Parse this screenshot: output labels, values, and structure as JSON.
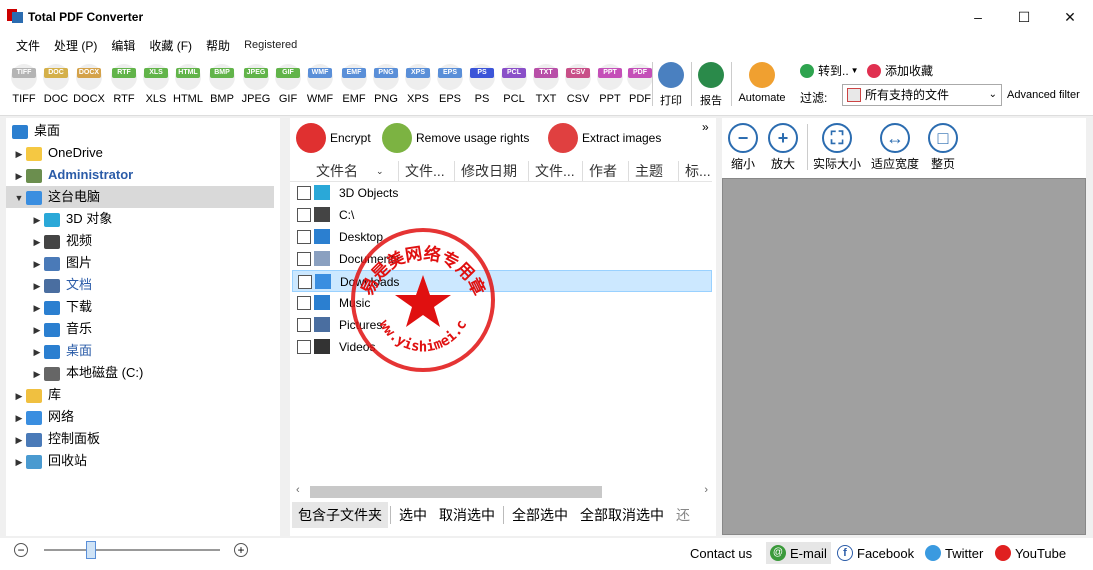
{
  "window": {
    "title": "Total PDF Converter"
  },
  "menu": {
    "items": [
      "文件",
      "处理 (P)",
      "编辑",
      "收藏 (F)",
      "帮助"
    ],
    "registered": "Registered"
  },
  "formats": [
    "TIFF",
    "DOC",
    "DOCX",
    "RTF",
    "XLS",
    "HTML",
    "BMP",
    "JPEG",
    "GIF",
    "WMF",
    "EMF",
    "PNG",
    "XPS",
    "EPS",
    "PS",
    "PCL",
    "TXT",
    "CSV",
    "PPT",
    "PDF"
  ],
  "format_colors": [
    "#b4b4b4",
    "#d4b04a",
    "#d4a24a",
    "#62b44a",
    "#62b44a",
    "#62b44a",
    "#62b44a",
    "#62b44a",
    "#62b44a",
    "#5a8fd8",
    "#5a8fd8",
    "#5a8fd8",
    "#5a8fd8",
    "#5a8fd8",
    "#3c55d8",
    "#8a4fc8",
    "#b84fa8",
    "#c84f88",
    "#c44fb8",
    "#c44fb8"
  ],
  "toolbar": {
    "print": "打印",
    "report": "报告",
    "automate": "Automate",
    "goto": "转到..",
    "add_favorite": "添加收藏",
    "filter_label": "过滤:",
    "filter_value": "所有支持的文件",
    "advanced_filter": "Advanced filter"
  },
  "tree": {
    "root": "桌面",
    "items": [
      {
        "label": "OneDrive",
        "level": 1
      },
      {
        "label": "Administrator",
        "level": 1
      },
      {
        "label": "这台电脑",
        "level": 1
      },
      {
        "label": "3D 对象",
        "level": 2
      },
      {
        "label": "视频",
        "level": 2
      },
      {
        "label": "图片",
        "level": 2
      },
      {
        "label": "文档",
        "level": 2
      },
      {
        "label": "下载",
        "level": 2
      },
      {
        "label": "音乐",
        "level": 2
      },
      {
        "label": "桌面",
        "level": 2
      },
      {
        "label": "本地磁盘 (C:)",
        "level": 2
      },
      {
        "label": "库",
        "level": 1
      },
      {
        "label": "网络",
        "level": 1
      },
      {
        "label": "控制面板",
        "level": 1
      },
      {
        "label": "回收站",
        "level": 1
      }
    ]
  },
  "actions": {
    "encrypt": "Encrypt",
    "remove_rights": "Remove usage rights",
    "extract_images": "Extract images"
  },
  "columns": [
    "文件名",
    "文件...",
    "修改日期",
    "文件...",
    "作者",
    "主题",
    "标..."
  ],
  "files": [
    "3D Objects",
    "C:\\",
    "Desktop",
    "Documents",
    "Downloads",
    "Music",
    "Pictures",
    "Videos"
  ],
  "bottom_tabs": {
    "include_sub": "包含子文件夹",
    "select": "选中",
    "deselect": "取消选中",
    "select_all": "全部选中",
    "deselect_all": "全部取消选中",
    "more": "还"
  },
  "zoom": {
    "zoom_out": "缩小",
    "zoom_in": "放大",
    "actual_size": "实际大小",
    "fit_width": "适应宽度",
    "whole_page": "整页"
  },
  "status": {
    "contact": "Contact us",
    "email": "E-mail",
    "facebook": "Facebook",
    "twitter": "Twitter",
    "youtube": "YouTube",
    "zoom_level": 0.25
  },
  "watermark": {
    "top_text": "易是美网络专用章",
    "bottom_text": "www.yishimei.cn"
  },
  "colors": {
    "accent": "#2b6cb0",
    "selection": "#cce8ff",
    "stamp_red": "#e01010"
  }
}
